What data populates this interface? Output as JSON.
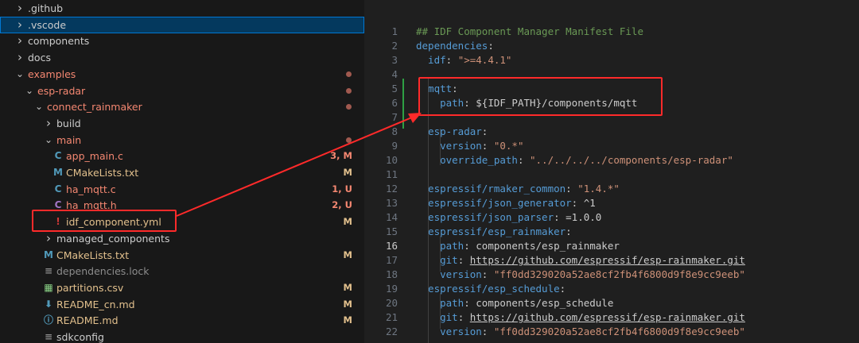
{
  "explorer": {
    "rows": [
      {
        "label": ".github",
        "chev": "›",
        "depth": 0,
        "color": "#cccccc"
      },
      {
        "label": ".vscode",
        "chev": "›",
        "depth": 0,
        "color": "#cccccc",
        "selected": true
      },
      {
        "label": "components",
        "chev": "›",
        "depth": 0,
        "color": "#cccccc"
      },
      {
        "label": "docs",
        "chev": "›",
        "depth": 0,
        "color": "#cccccc"
      },
      {
        "label": "examples",
        "chev": "⌄",
        "depth": 0,
        "color": "#f48771",
        "dot": true
      },
      {
        "label": "esp-radar",
        "chev": "⌄",
        "depth": 1,
        "color": "#f48771",
        "dot": true
      },
      {
        "label": "connect_rainmaker",
        "chev": "⌄",
        "depth": 2,
        "color": "#f48771",
        "dot": true
      },
      {
        "label": "build",
        "chev": "›",
        "depth": 3,
        "color": "#cccccc"
      },
      {
        "label": "main",
        "chev": "⌄",
        "depth": 3,
        "color": "#f48771",
        "dot": true
      },
      {
        "label": "app_main.c",
        "icon": "C",
        "iconColor": "#519aba",
        "depth": 4,
        "color": "#f48771",
        "badge": "3, M",
        "badgeColor": "#f48771"
      },
      {
        "label": "CMakeLists.txt",
        "icon": "M",
        "iconColor": "#519aba",
        "depth": 4,
        "color": "#e2c08d",
        "badge": "M",
        "badgeColor": "#e2c08d"
      },
      {
        "label": "ha_mqtt.c",
        "icon": "C",
        "iconColor": "#519aba",
        "depth": 4,
        "color": "#f48771",
        "badge": "1, U",
        "badgeColor": "#f48771"
      },
      {
        "label": "ha_mqtt.h",
        "icon": "C",
        "iconColor": "#a074c4",
        "depth": 4,
        "color": "#f48771",
        "badge": "2, U",
        "badgeColor": "#f48771"
      },
      {
        "label": "idf_component.yml",
        "icon": "!",
        "iconColor": "#cb3837",
        "depth": 4,
        "color": "#e2c08d",
        "badge": "M",
        "badgeColor": "#e2c08d"
      },
      {
        "label": "managed_components",
        "chev": "›",
        "depth": 3,
        "color": "#cccccc"
      },
      {
        "label": "CMakeLists.txt",
        "icon": "M",
        "iconColor": "#519aba",
        "depth": 3,
        "color": "#e2c08d",
        "badge": "M",
        "badgeColor": "#e2c08d"
      },
      {
        "label": "dependencies.lock",
        "icon": "≡",
        "iconColor": "#8c8c8c",
        "depth": 3,
        "color": "#8c8c8c"
      },
      {
        "label": "partitions.csv",
        "icon": "▦",
        "iconColor": "#89d185",
        "depth": 3,
        "color": "#e2c08d",
        "badge": "M",
        "badgeColor": "#e2c08d"
      },
      {
        "label": "README_cn.md",
        "icon": "⬇",
        "iconColor": "#519aba",
        "depth": 3,
        "color": "#e2c08d",
        "badge": "M",
        "badgeColor": "#e2c08d"
      },
      {
        "label": "README.md",
        "icon": "ⓘ",
        "iconColor": "#519aba",
        "depth": 3,
        "color": "#e2c08d",
        "badge": "M",
        "badgeColor": "#e2c08d"
      },
      {
        "label": "sdkconfig",
        "icon": "≡",
        "iconColor": "#8c8c8c",
        "depth": 3,
        "color": "#cccccc"
      }
    ]
  },
  "editor": {
    "active_line": 16,
    "lines": [
      {
        "n": "1",
        "tokens": [
          [
            "## IDF Component Manager Manifest File",
            "cm"
          ]
        ]
      },
      {
        "n": "2",
        "tokens": [
          [
            "dependencies",
            "key"
          ],
          [
            ":",
            "pl"
          ]
        ]
      },
      {
        "n": "3",
        "tokens": [
          [
            "  idf",
            "key"
          ],
          [
            ": ",
            "pl"
          ],
          [
            "\">=4.4.1\"",
            "str"
          ]
        ]
      },
      {
        "n": "4",
        "tokens": []
      },
      {
        "n": "5",
        "tokens": [
          [
            "  mqtt",
            "key"
          ],
          [
            ":",
            "pl"
          ]
        ]
      },
      {
        "n": "6",
        "tokens": [
          [
            "    path",
            "key"
          ],
          [
            ": ${IDF_PATH}/components/mqtt",
            "pl"
          ]
        ]
      },
      {
        "n": "7",
        "tokens": []
      },
      {
        "n": "8",
        "tokens": [
          [
            "  esp-radar",
            "key"
          ],
          [
            ":",
            "pl"
          ]
        ]
      },
      {
        "n": "9",
        "tokens": [
          [
            "    version",
            "key"
          ],
          [
            ": ",
            "pl"
          ],
          [
            "\"0.*\"",
            "str"
          ]
        ]
      },
      {
        "n": "10",
        "tokens": [
          [
            "    override_path",
            "key"
          ],
          [
            ": ",
            "pl"
          ],
          [
            "\"../../../../components/esp-radar\"",
            "str"
          ]
        ]
      },
      {
        "n": "11",
        "tokens": []
      },
      {
        "n": "12",
        "tokens": [
          [
            "  espressif/rmaker_common",
            "key"
          ],
          [
            ": ",
            "pl"
          ],
          [
            "\"1.4.*\"",
            "str"
          ]
        ]
      },
      {
        "n": "13",
        "tokens": [
          [
            "  espressif/json_generator",
            "key"
          ],
          [
            ": ^1",
            "pl"
          ]
        ]
      },
      {
        "n": "14",
        "tokens": [
          [
            "  espressif/json_parser",
            "key"
          ],
          [
            ": =1.0.0",
            "pl"
          ]
        ]
      },
      {
        "n": "15",
        "tokens": [
          [
            "  espressif/esp_rainmaker",
            "key"
          ],
          [
            ":",
            "pl"
          ]
        ]
      },
      {
        "n": "16",
        "tokens": [
          [
            "    path",
            "key"
          ],
          [
            ": components/esp_rainmaker",
            "pl"
          ]
        ]
      },
      {
        "n": "17",
        "tokens": [
          [
            "    git",
            "key"
          ],
          [
            ": ",
            "pl"
          ],
          [
            "https://github.com/espressif/esp-rainmaker.git",
            "url"
          ]
        ]
      },
      {
        "n": "18",
        "tokens": [
          [
            "    version",
            "key"
          ],
          [
            ": ",
            "pl"
          ],
          [
            "\"ff0dd329020a52ae8cf2fb4f6800d9f8e9cc9eeb\"",
            "str"
          ]
        ]
      },
      {
        "n": "19",
        "tokens": [
          [
            "  espressif/esp_schedule",
            "key"
          ],
          [
            ":",
            "pl"
          ]
        ]
      },
      {
        "n": "20",
        "tokens": [
          [
            "    path",
            "key"
          ],
          [
            ": components/esp_schedule",
            "pl"
          ]
        ]
      },
      {
        "n": "21",
        "tokens": [
          [
            "    git",
            "key"
          ],
          [
            ": ",
            "pl"
          ],
          [
            "https://github.com/espressif/esp-rainmaker.git",
            "url"
          ]
        ]
      },
      {
        "n": "22",
        "tokens": [
          [
            "    version",
            "key"
          ],
          [
            ": ",
            "pl"
          ],
          [
            "\"ff0dd329020a52ae8cf2fb4f6800d9f8e9cc9eeb\"",
            "str"
          ]
        ]
      }
    ]
  },
  "colors": {
    "highlight": "#ff2a2a",
    "selection": "#04395e",
    "git_added": "#2ea043"
  }
}
